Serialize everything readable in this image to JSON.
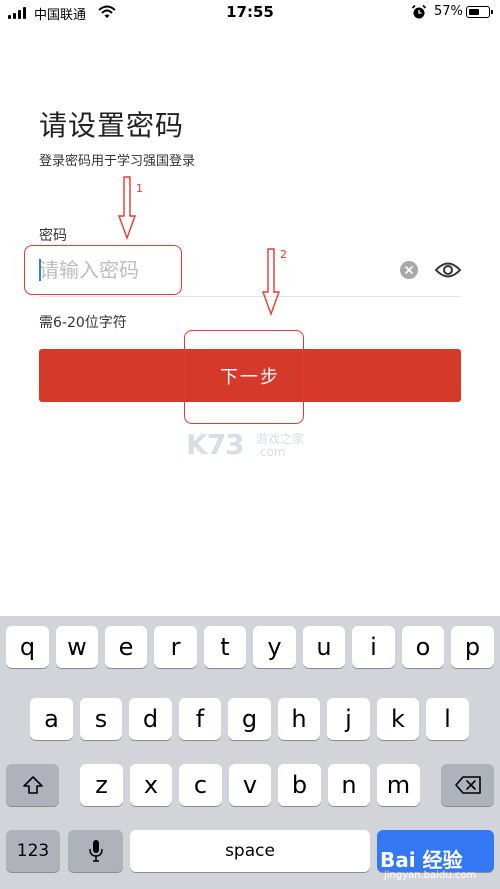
{
  "status_bar": {
    "carrier": "中国联通",
    "time": "17:55",
    "battery_percent": "57%",
    "battery_level": 0.57
  },
  "page": {
    "title": "请设置密码",
    "subtitle": "登录密码用于学习强国登录",
    "field_label": "密码",
    "password_placeholder": "请输入密码",
    "hint": "需6-20位字符",
    "next_button": "下一步"
  },
  "annotations": {
    "step1": "1",
    "step2": "2",
    "color": "#e53935"
  },
  "watermarks": {
    "site_logo": "K73",
    "site_sub1": "游戏之家",
    "site_sub2": ".com",
    "baidu_logo": "Bai 经验",
    "baidu_url": "jingyan.baidu.com"
  },
  "keyboard": {
    "row1": [
      "q",
      "w",
      "e",
      "r",
      "t",
      "y",
      "u",
      "i",
      "o",
      "p"
    ],
    "row2": [
      "a",
      "s",
      "d",
      "f",
      "g",
      "h",
      "j",
      "k",
      "l"
    ],
    "row3": [
      "z",
      "x",
      "c",
      "v",
      "b",
      "n",
      "m"
    ],
    "numbers_key": "123",
    "space_key": "space",
    "icons": [
      "shift-icon",
      "backspace-icon",
      "microphone-icon"
    ]
  },
  "colors": {
    "accent": "#d5392a",
    "caret": "#3a7bd5",
    "keyboard_bg": "#d1d4d9",
    "return_key": "#3478f6"
  }
}
